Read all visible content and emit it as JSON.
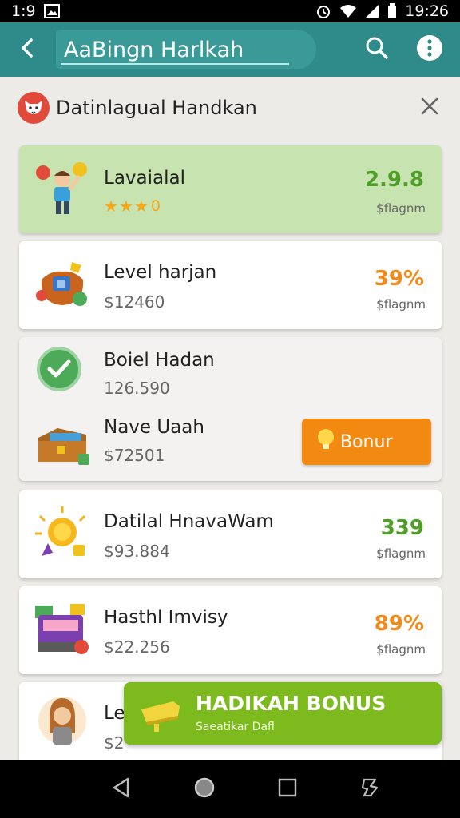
{
  "status_bar": {
    "time_left": "1:9",
    "time_right": "19:26"
  },
  "app_bar": {
    "title": "AaBingn Harlkah"
  },
  "section": {
    "title": "Datinlagual Handkan"
  },
  "rows": [
    {
      "name": "Lavaialal",
      "rating": "0",
      "value": "2.9.8",
      "caption": "$flagnm",
      "value_color": "#4f9e27"
    },
    {
      "name": "Level harjan",
      "sub": "$12460",
      "value": "39%",
      "caption": "$flagnm",
      "value_color": "#f08a1c"
    },
    {
      "name": "Boiel Hadan",
      "sub": "126.590"
    },
    {
      "name": "Nave Uaah",
      "sub": "$72501",
      "button": "Bonur"
    },
    {
      "name": "Datilal HnavaWam",
      "sub": "$93.884",
      "value": "339",
      "caption": "$flagnm",
      "value_color": "#4f9e27"
    },
    {
      "name": "Hasthl Imvisy",
      "sub": "$22.256",
      "value": "89%",
      "caption": "$flagnm",
      "value_color": "#f08a1c"
    },
    {
      "name": "Le",
      "sub": "$2"
    }
  ],
  "bonus_banner": {
    "title": "HADIKAH BONUS",
    "subtitle": "Saeatikar Dafl"
  },
  "icons": {
    "back": "arrow-left-icon",
    "search": "search-icon",
    "more": "more-vert-icon",
    "close": "close-icon",
    "nav_back": "nav-back-icon",
    "nav_home": "nav-home-icon",
    "nav_recents": "nav-recents-icon",
    "nav_extra": "nav-extra-icon"
  },
  "colors": {
    "app_bar": "#2e8b8a",
    "highlight": "#c7e4b0",
    "bonus_button": "#f28a12",
    "banner": "#7dba1e"
  }
}
